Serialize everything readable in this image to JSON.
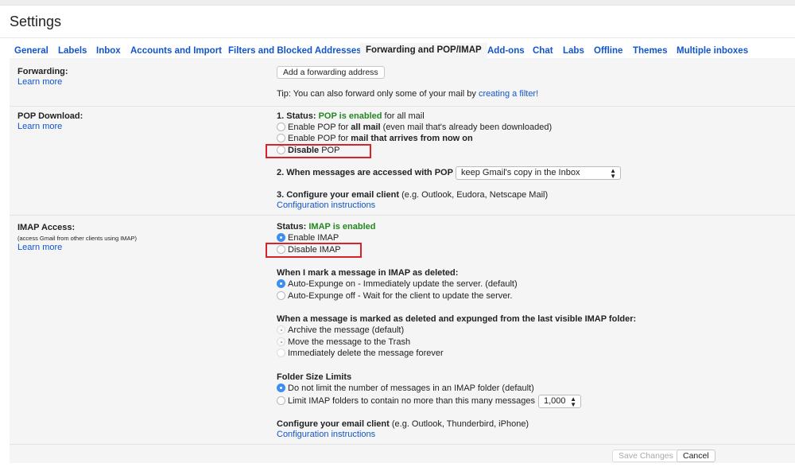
{
  "header": {
    "title": "Settings"
  },
  "tabs": [
    {
      "label": "General"
    },
    {
      "label": "Labels"
    },
    {
      "label": "Inbox"
    },
    {
      "label": "Accounts and Import"
    },
    {
      "label": "Filters and Blocked Addresses"
    },
    {
      "label": "Forwarding and POP/IMAP",
      "active": true
    },
    {
      "label": "Add-ons"
    },
    {
      "label": "Chat"
    },
    {
      "label": "Labs"
    },
    {
      "label": "Offline"
    },
    {
      "label": "Themes"
    },
    {
      "label": "Multiple inboxes"
    }
  ],
  "forwarding": {
    "label": "Forwarding:",
    "learn_more": "Learn more",
    "add_button": "Add a forwarding address",
    "tip_prefix": "Tip: You can also forward only some of your mail by ",
    "tip_link": "creating a filter!"
  },
  "pop": {
    "label": "POP Download:",
    "learn_more": "Learn more",
    "status_prefix": "1. Status: ",
    "status_value": "POP is enabled",
    "status_suffix": " for all mail",
    "options": [
      {
        "pre": "Enable POP for ",
        "bold": "all mail",
        "post": " (even mail that's already been downloaded)",
        "selected": false
      },
      {
        "pre": "Enable POP for ",
        "bold": "mail that arrives from now on",
        "post": "",
        "selected": false
      },
      {
        "pre": "",
        "bold": "Disable",
        "post": " POP",
        "selected": false,
        "highlighted": true
      }
    ],
    "access_label": "2. When messages are accessed with POP",
    "access_value": "keep Gmail's copy in the Inbox",
    "configure_bold": "3. Configure your email client",
    "configure_rest": " (e.g. Outlook, Eudora, Netscape Mail)",
    "config_link": "Configuration instructions"
  },
  "imap": {
    "label": "IMAP Access:",
    "sublabel": "(access Gmail from other clients using IMAP)",
    "learn_more": "Learn more",
    "status_prefix": "Status: ",
    "status_value": "IMAP is enabled",
    "options": [
      {
        "label": "Enable IMAP",
        "selected": true
      },
      {
        "label": "Disable IMAP",
        "selected": false,
        "highlighted": true
      }
    ],
    "deleted_heading": "When I mark a message in IMAP as deleted:",
    "deleted_options": [
      {
        "label": "Auto-Expunge on - Immediately update the server. (default)",
        "selected": true
      },
      {
        "label": "Auto-Expunge off - Wait for the client to update the server.",
        "selected": false
      }
    ],
    "expunged_heading": "When a message is marked as deleted and expunged from the last visible IMAP folder:",
    "expunged_options": [
      {
        "label": "Archive the message (default)",
        "selected": true
      },
      {
        "label": "Move the message to the Trash",
        "selected": false
      },
      {
        "label": "Immediately delete the message forever",
        "selected": false
      }
    ],
    "folder_heading": "Folder Size Limits",
    "folder_options": [
      {
        "label": "Do not limit the number of messages in an IMAP folder (default)",
        "selected": true
      },
      {
        "label": "Limit IMAP folders to contain no more than this many messages",
        "selected": false
      }
    ],
    "folder_limit_value": "1,000",
    "configure_bold": "Configure your email client",
    "configure_rest": " (e.g. Outlook, Thunderbird, iPhone)",
    "config_link": "Configuration instructions"
  },
  "footer": {
    "save": "Save Changes",
    "cancel": "Cancel"
  },
  "colors": {
    "link": "#1155cc",
    "status_green": "#228822",
    "highlight_box": "#d9222a",
    "radio_selected": "#3d8ef0"
  }
}
